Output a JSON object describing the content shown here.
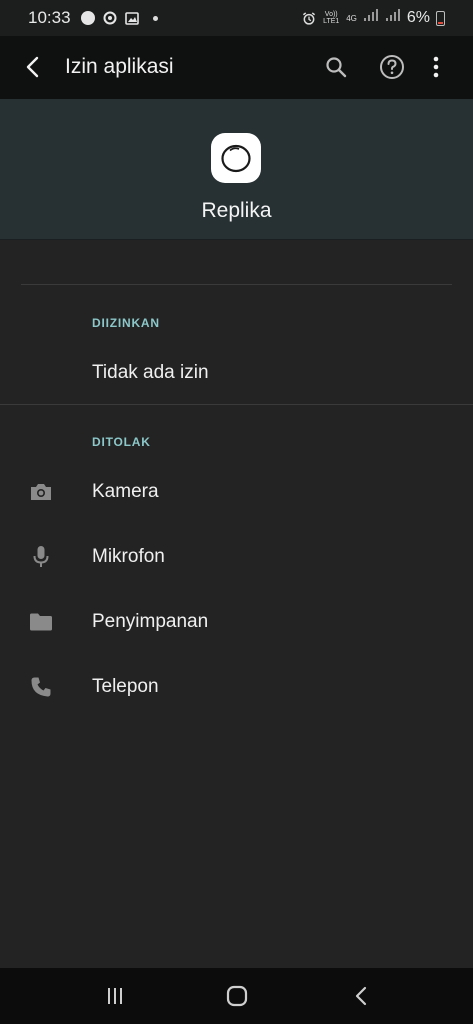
{
  "status_bar": {
    "time": "10:33",
    "network_label_top": "Vo)) LTE1",
    "network_type": "4G",
    "battery_percent": "6%"
  },
  "app_bar": {
    "title": "Izin aplikasi",
    "icons": [
      "back-arrow-icon",
      "search-icon",
      "help-icon",
      "more-vert-icon"
    ]
  },
  "header": {
    "app_name": "Replika"
  },
  "sections": {
    "allowed": {
      "label": "DIIZINKAN",
      "empty_text": "Tidak ada izin"
    },
    "denied": {
      "label": "DITOLAK",
      "items": [
        {
          "label": "Kamera",
          "icon": "camera-icon"
        },
        {
          "label": "Mikrofon",
          "icon": "microphone-icon"
        },
        {
          "label": "Penyimpanan",
          "icon": "folder-icon"
        },
        {
          "label": "Telepon",
          "icon": "phone-icon"
        }
      ]
    }
  },
  "colors": {
    "background": "#232323",
    "app_bar": "#0f1010",
    "header": "#273033",
    "section_label": "#8cc7c9",
    "icon_gray": "#8a8a8a"
  }
}
